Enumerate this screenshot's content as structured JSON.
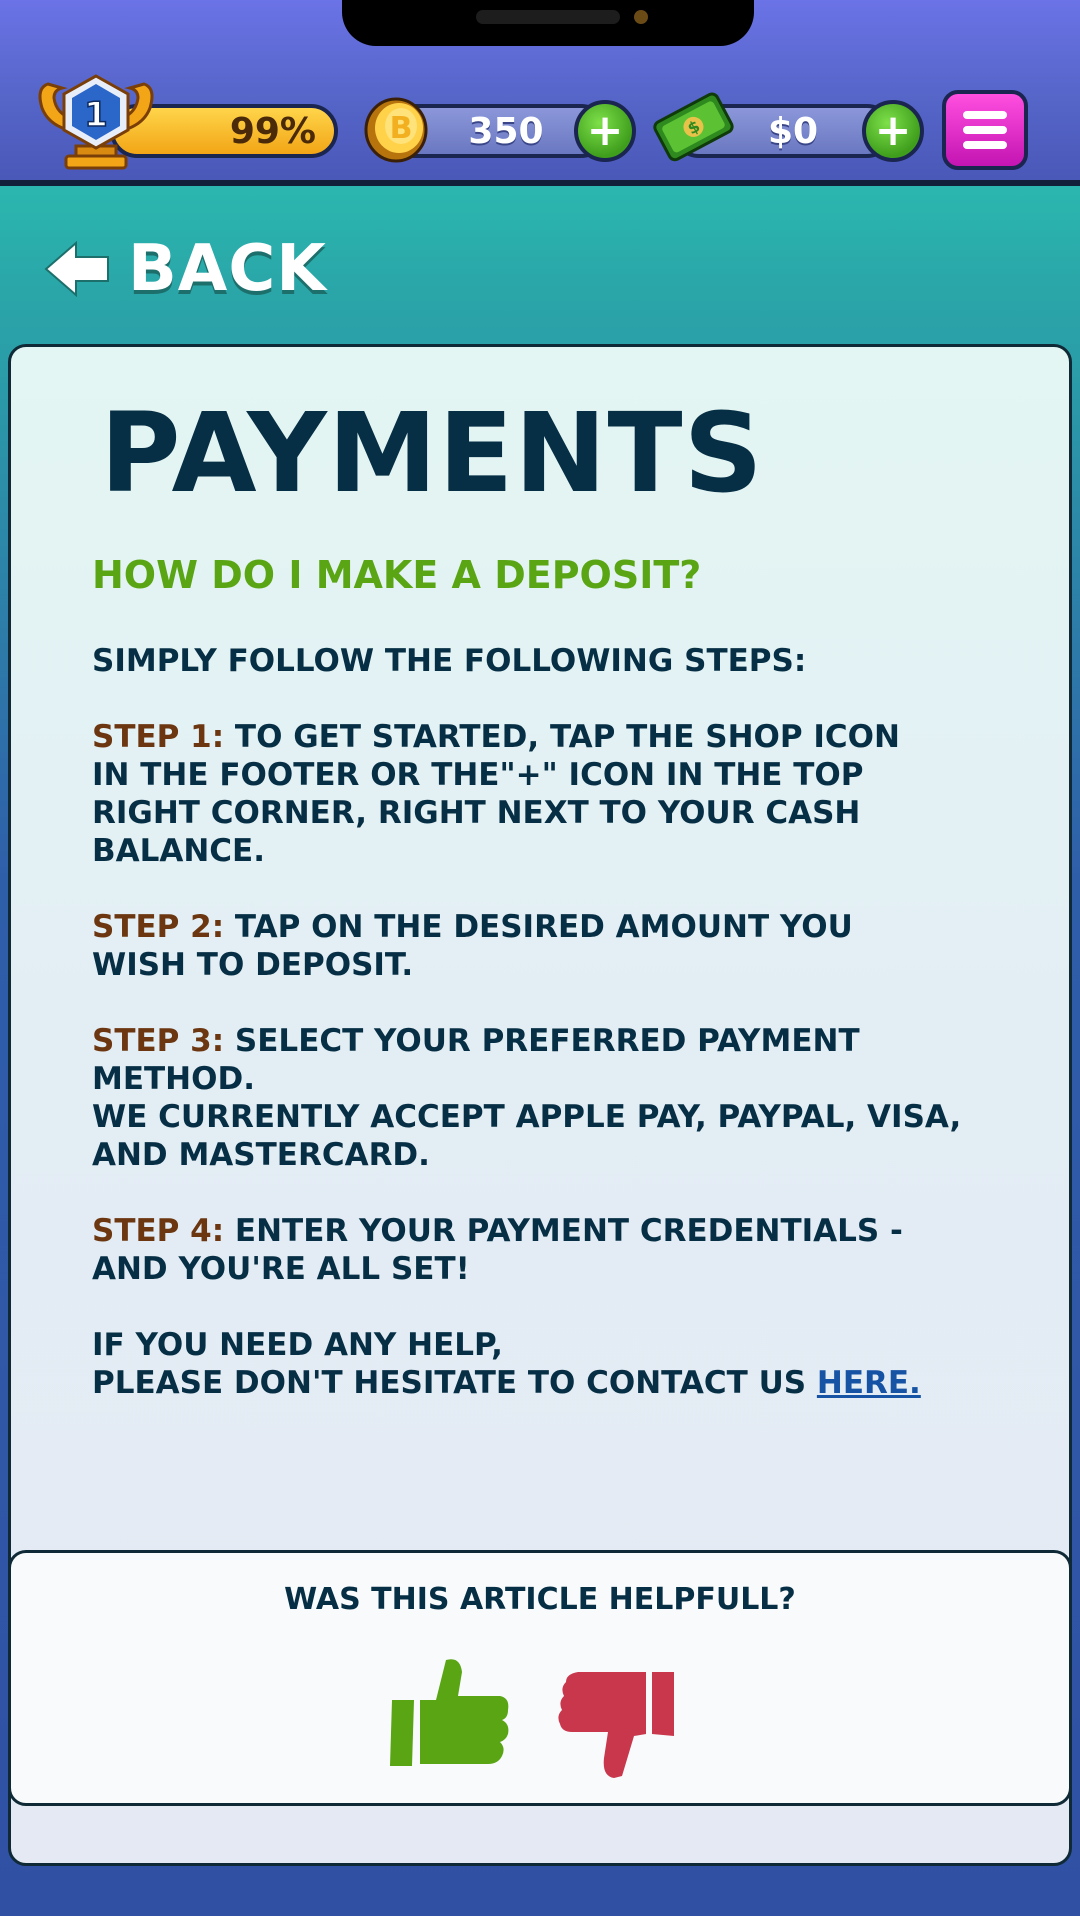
{
  "hud": {
    "level": "1",
    "xp_percent": "99%",
    "coins": "350",
    "cash": "$0"
  },
  "nav": {
    "back_label": "BACK"
  },
  "article": {
    "title": "PAYMENTS",
    "question": "HOW DO I MAKE A DEPOSIT?",
    "intro": "SIMPLY FOLLOW THE FOLLOWING STEPS:",
    "steps": [
      {
        "label": "STEP 1:",
        "line1": " TO GET STARTED, TAP THE SHOP ICON",
        "line2": "IN THE FOOTER OR THE\"+\" ICON IN THE TOP",
        "line3": "RIGHT CORNER, RIGHT NEXT TO YOUR CASH BALANCE."
      },
      {
        "label": "STEP 2:",
        "line1": " TAP ON THE DESIRED AMOUNT YOU",
        "line2": "WISH TO DEPOSIT."
      },
      {
        "label": "STEP 3:",
        "line1": " SELECT YOUR PREFERRED PAYMENT METHOD.",
        "line2": " WE CURRENTLY ACCEPT APPLE PAY, PAYPAL, VISA,",
        "line3": "AND MASTERCARD."
      },
      {
        "label": "STEP 4:",
        "line1": " ENTER YOUR PAYMENT CREDENTIALS -",
        "line2": "AND YOU'RE ALL SET!"
      }
    ],
    "help_line1": "IF YOU NEED ANY HELP,",
    "help_line2": "PLEASE DON'T HESITATE TO CONTACT US ",
    "help_link": "HERE."
  },
  "feedback": {
    "question": "WAS THIS ARTICLE HELPFULL?"
  },
  "icons": {
    "trophy": "trophy-icon",
    "coin": "coin-icon",
    "cash": "cash-icon",
    "plus": "plus-icon",
    "menu": "hamburger-menu-icon",
    "back": "arrow-left-icon",
    "thumbs_up": "thumbs-up-icon",
    "thumbs_down": "thumbs-down-icon"
  },
  "colors": {
    "title": "#062f45",
    "question": "#5aa514",
    "step_label": "#6b3610",
    "link": "#1653a4",
    "thumbs_up": "#5aa514",
    "thumbs_down": "#c8374b"
  }
}
